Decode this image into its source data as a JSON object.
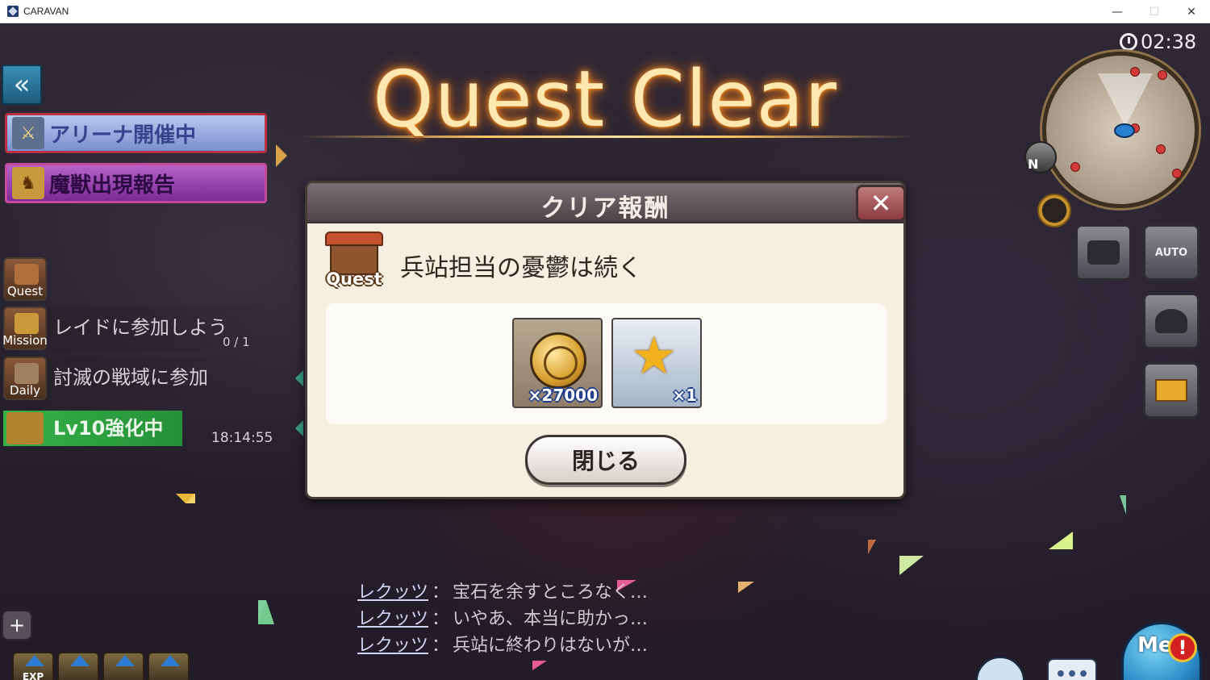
{
  "window": {
    "title": "CARAVAN",
    "minimize": "—",
    "maximize": "☐",
    "close": "✕"
  },
  "banner": {
    "title": "Quest Clear"
  },
  "left_panel": {
    "back_label": "«",
    "arena_label": "アリーナ開催中",
    "beast_label": "魔獣出現報告",
    "quest_icon_label": "Quest",
    "mission_icon_label": "Mission",
    "daily_icon_label": "Daily",
    "mission_text": "レイドに参加しよう",
    "mission_count": "0 / 1",
    "daily_text": "討滅の戦域に参加",
    "lv_text": "Lv10強化中",
    "lv_time": "18:14:55"
  },
  "modal": {
    "title": "クリア報酬",
    "close_label": "✕",
    "quest_badge": "Quest",
    "quest_name": "兵站担当の憂鬱は続く",
    "rewards": [
      {
        "icon": "gold-coin-icon",
        "qty": "×27000"
      },
      {
        "icon": "star-icon",
        "qty": "×1"
      }
    ],
    "close_button": "閉じる"
  },
  "hud": {
    "timer": "02:38",
    "north_label": "N",
    "auto_label": "AUTO",
    "menu_label": "Me",
    "alert_label": "!"
  },
  "chat": [
    {
      "name": "レクッツ",
      "sep": "：",
      "text": "宝石を余すところなく…"
    },
    {
      "name": "レクッツ",
      "sep": "：",
      "text": "いやあ、本当に助かっ…"
    },
    {
      "name": "レクッツ",
      "sep": "：",
      "text": "兵站に終わりはないが…"
    }
  ],
  "bottom_left": {
    "plus_label": "+",
    "exp_label": "EXP"
  },
  "bottom_right": {
    "chat_bubble_label": "•••"
  },
  "colors": {
    "banner_glow": "#ff9a2a",
    "modal_bg": "#f4efe0",
    "lv_green": "#35b14a"
  }
}
